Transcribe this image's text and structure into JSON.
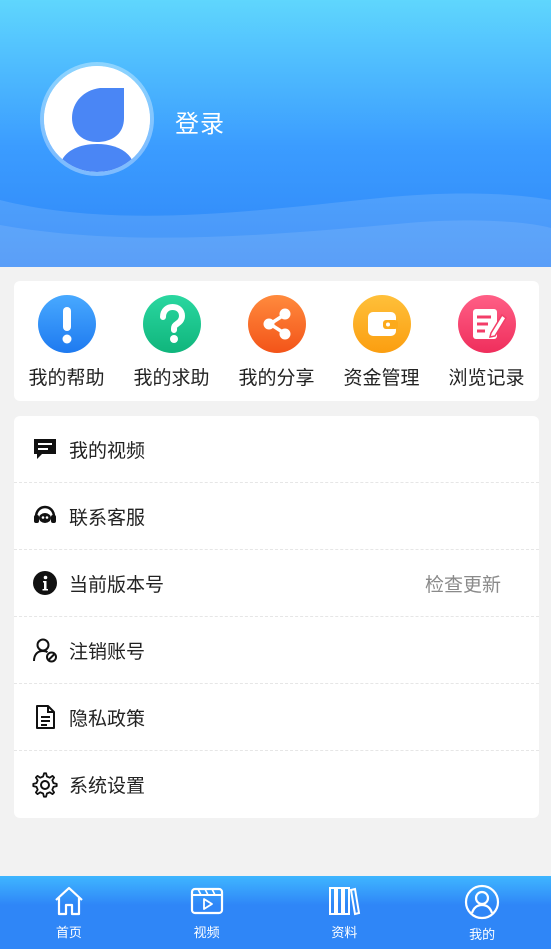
{
  "header": {
    "login_label": "登录"
  },
  "quick_actions": [
    {
      "label": "我的帮助",
      "icon": "exclamation-icon",
      "color": "#2f8ff5"
    },
    {
      "label": "我的求助",
      "icon": "question-icon",
      "color": "#1cc48e"
    },
    {
      "label": "我的分享",
      "icon": "share-icon",
      "color": "#fb6a26"
    },
    {
      "label": "资金管理",
      "icon": "wallet-icon",
      "color": "#fdae1c"
    },
    {
      "label": "浏览记录",
      "icon": "edit-note-icon",
      "color": "#f6426c"
    }
  ],
  "menu": [
    {
      "label": "我的视频",
      "icon": "message-icon"
    },
    {
      "label": "联系客服",
      "icon": "headset-icon"
    },
    {
      "label": "当前版本号",
      "icon": "info-icon",
      "right": "检查更新"
    },
    {
      "label": "注销账号",
      "icon": "user-remove-icon"
    },
    {
      "label": "隐私政策",
      "icon": "document-icon"
    },
    {
      "label": "系统设置",
      "icon": "gear-icon"
    }
  ],
  "bottom_nav": [
    {
      "label": "首页",
      "icon": "home-icon"
    },
    {
      "label": "视频",
      "icon": "video-icon"
    },
    {
      "label": "资料",
      "icon": "books-icon"
    },
    {
      "label": "我的",
      "icon": "user-icon"
    }
  ]
}
